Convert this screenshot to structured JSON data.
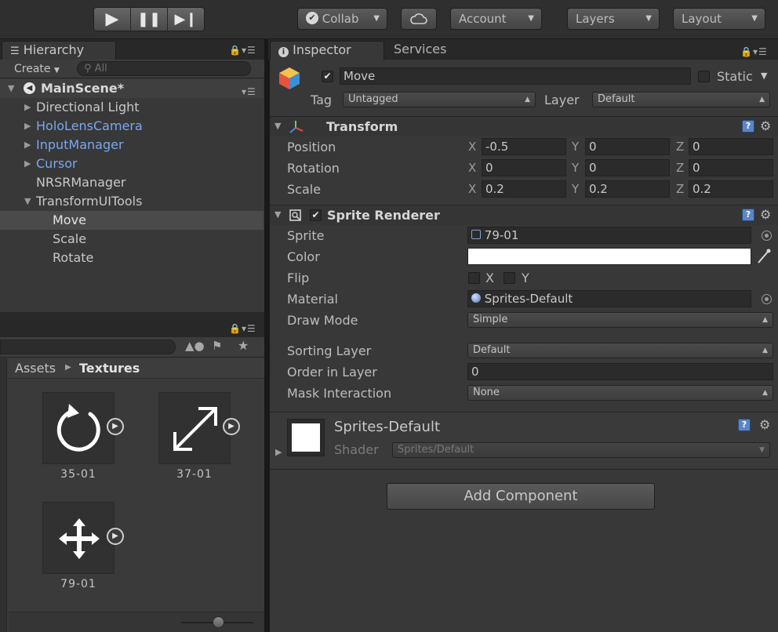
{
  "toolbar": {
    "collab_label": "Collab",
    "account_label": "Account",
    "layers_label": "Layers",
    "layout_label": "Layout"
  },
  "hierarchy": {
    "tab_label": "Hierarchy",
    "create_label": "Create",
    "search_placeholder": "All",
    "scene_name": "MainScene*",
    "items": [
      {
        "label": "Directional Light"
      },
      {
        "label": "HoloLensCamera"
      },
      {
        "label": "InputManager"
      },
      {
        "label": "Cursor"
      },
      {
        "label": "NRSRManager"
      },
      {
        "label": "TransformUITools"
      },
      {
        "label": "Move"
      },
      {
        "label": "Scale"
      },
      {
        "label": "Rotate"
      }
    ]
  },
  "project": {
    "breadcrumb_root": "Assets",
    "breadcrumb_folder": "Textures",
    "assets": [
      {
        "name": "35-01",
        "icon": "rotate-icon"
      },
      {
        "name": "37-01",
        "icon": "scale-arrows-icon"
      },
      {
        "name": "79-01",
        "icon": "move-arrows-icon"
      }
    ]
  },
  "inspector": {
    "tab_label": "Inspector",
    "services_tab_label": "Services",
    "object_name": "Move",
    "static_label": "Static",
    "tag_label": "Tag",
    "tag_value": "Untagged",
    "layer_label": "Layer",
    "layer_value": "Default",
    "transform": {
      "title": "Transform",
      "rows": [
        {
          "label": "Position",
          "x": "-0.5",
          "y": "0",
          "z": "0"
        },
        {
          "label": "Rotation",
          "x": "0",
          "y": "0",
          "z": "0"
        },
        {
          "label": "Scale",
          "x": "0.2",
          "y": "0.2",
          "z": "0.2"
        }
      ],
      "axis_x": "X",
      "axis_y": "Y",
      "axis_z": "Z"
    },
    "sprite_renderer": {
      "title": "Sprite Renderer",
      "sprite_label": "Sprite",
      "sprite_value": "79-01",
      "color_label": "Color",
      "color_value": "#ffffff",
      "flip_label": "Flip",
      "flip_x": "X",
      "flip_y": "Y",
      "material_label": "Material",
      "material_value": "Sprites-Default",
      "draw_mode_label": "Draw Mode",
      "draw_mode_value": "Simple",
      "sorting_layer_label": "Sorting Layer",
      "sorting_layer_value": "Default",
      "order_label": "Order in Layer",
      "order_value": "0",
      "mask_label": "Mask Interaction",
      "mask_value": "None"
    },
    "material": {
      "name": "Sprites-Default",
      "shader_label": "Shader",
      "shader_value": "Sprites/Default"
    },
    "add_component_label": "Add Component"
  },
  "colors": {
    "accent_blue": "#7aa7f0",
    "panel_bg": "#383838",
    "toolbar_bg": "#2f2f2f"
  }
}
